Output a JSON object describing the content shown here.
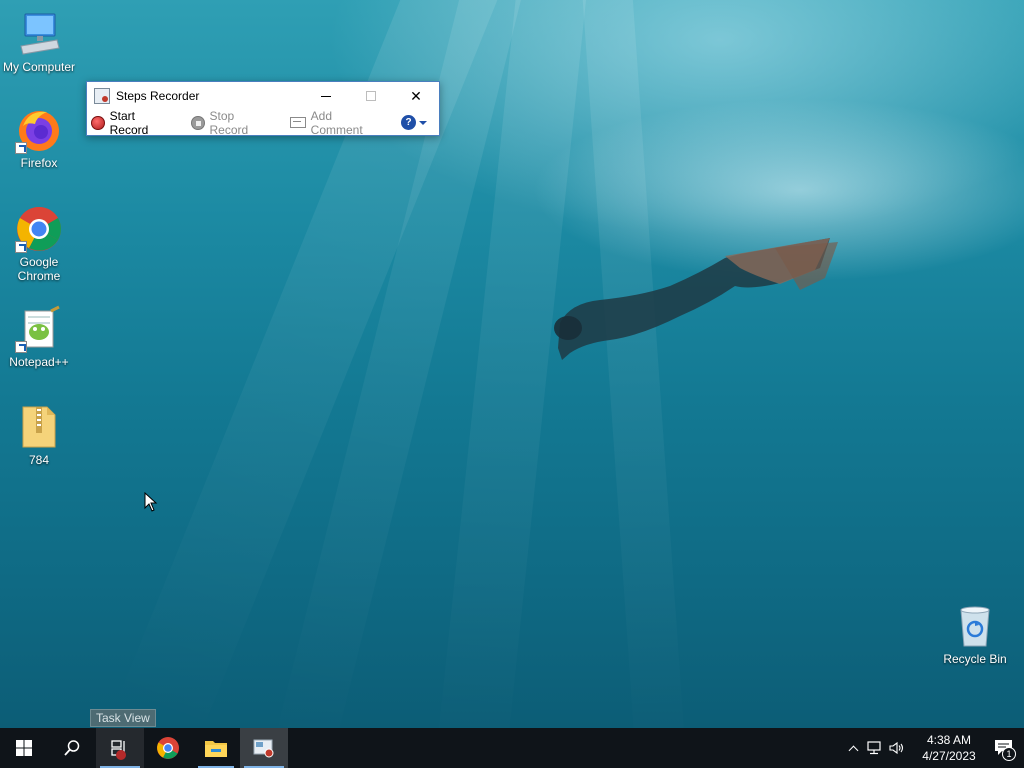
{
  "desktop": {
    "icons": [
      {
        "label": "My Computer",
        "icon": "my-computer-icon"
      },
      {
        "label": "Firefox",
        "icon": "firefox-icon"
      },
      {
        "label": "Google Chrome",
        "icon": "chrome-icon"
      },
      {
        "label": "Notepad++",
        "icon": "notepad-plus-plus-icon"
      },
      {
        "label": "784",
        "icon": "zip-folder-icon"
      },
      {
        "label": "Recycle Bin",
        "icon": "recycle-bin-icon"
      }
    ]
  },
  "steps_recorder": {
    "title": "Steps Recorder",
    "start_record": "Start Record",
    "stop_record": "Stop Record",
    "add_comment": "Add Comment",
    "minimize": "—",
    "close": "✕"
  },
  "taskbar": {
    "tooltip": "Task View",
    "clock_time": "4:38 AM",
    "clock_date": "4/27/2023",
    "notification_count": "1"
  },
  "colors": {
    "record_red": "#c0392b",
    "taskbar_bg": "#0f1419",
    "accent_blue": "#7fb3e6"
  }
}
